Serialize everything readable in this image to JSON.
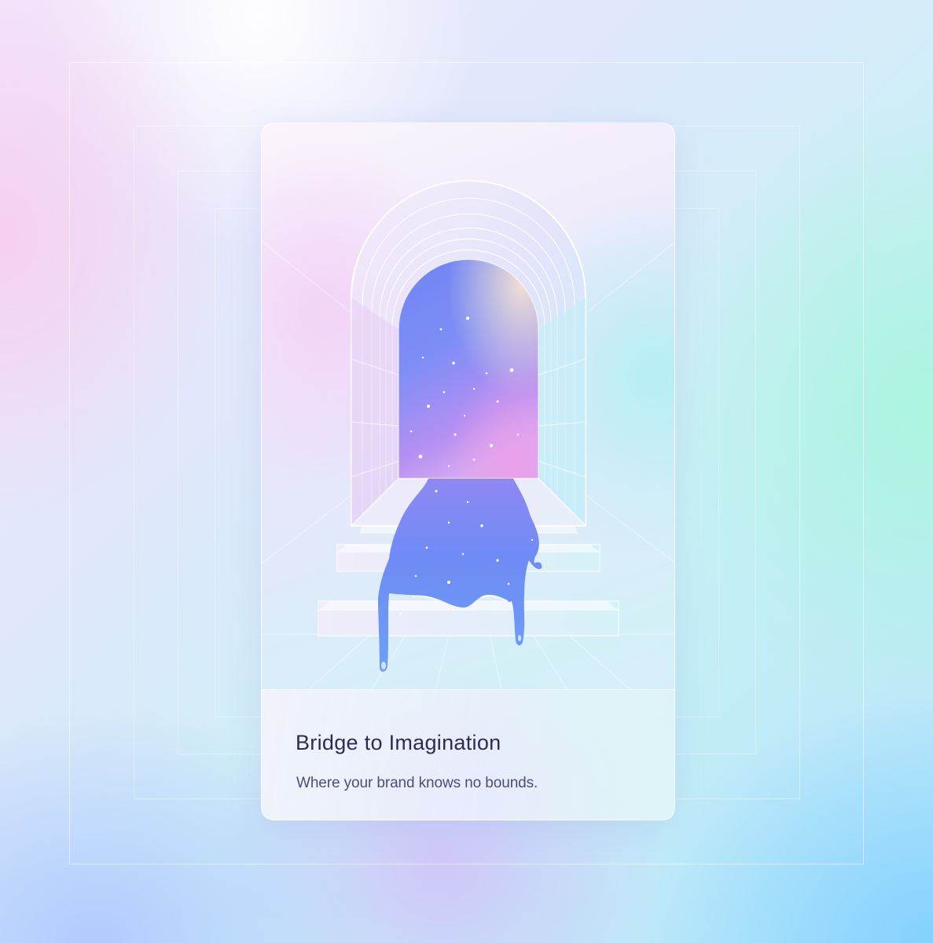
{
  "card": {
    "title": "Bridge to Imagination",
    "subtitle": "Where your brand knows no bounds."
  },
  "illustration": {
    "icon": "archway-portal-illustration"
  },
  "colors": {
    "title_text": "#2e2c55",
    "subtitle_text": "#4f4d77",
    "portal_top": "#6f8cf7",
    "portal_bottom": "#c9a6f5",
    "liquid": "#6b8ff5"
  }
}
